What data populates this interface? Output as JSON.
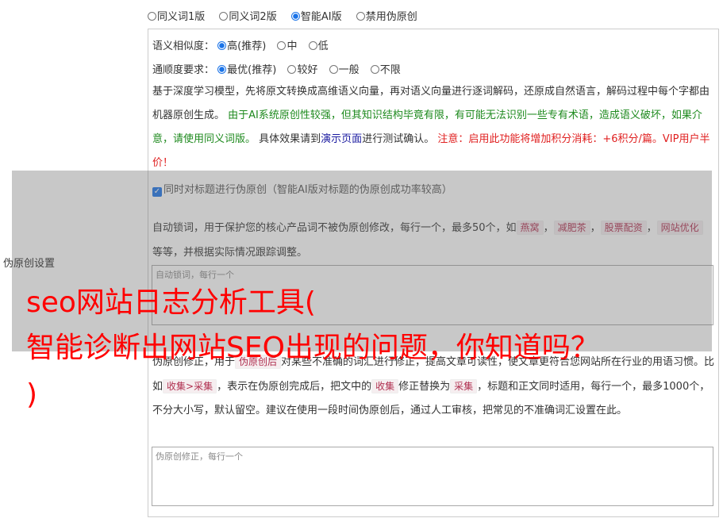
{
  "mode_options": [
    {
      "label": "同义词1版",
      "selected": false
    },
    {
      "label": "同义词2版",
      "selected": false
    },
    {
      "label": "智能AI版",
      "selected": true
    },
    {
      "label": "禁用伪原创",
      "selected": false
    }
  ],
  "similarity": {
    "label": "语义相似度：",
    "options": [
      {
        "label": "高(推荐)",
        "selected": true
      },
      {
        "label": "中",
        "selected": false
      },
      {
        "label": "低",
        "selected": false
      }
    ]
  },
  "fluency": {
    "label": "通顺度要求：",
    "options": [
      {
        "label": "最优(推荐)",
        "selected": true
      },
      {
        "label": "较好",
        "selected": false
      },
      {
        "label": "一般",
        "selected": false
      },
      {
        "label": "不限",
        "selected": false
      }
    ]
  },
  "description": {
    "part1": "基于深度学习模型，先将原文转换成高维语义向量，再对语义向量进行逐词解码，还原成自然语言，解码过程中每个字都由机器原创生成。",
    "part2_green": "由于AI系统原创性较强，但其知识结构毕竟有限，有可能无法识别一些专有术语，造成语义破坏，如果介意，请使用同义词版。",
    "part3": "具体效果请到",
    "link": "演示页面",
    "part4": "进行测试确认。",
    "part5_red": "注意：启用此功能将增加积分消耗：+6积分/篇。VIP用户半价！"
  },
  "title_checkbox": {
    "label": "同时对标题进行伪原创（智能AI版对标题的伪原创成功率较高）",
    "checked": true
  },
  "side_label": "伪原创设置",
  "lock_words": {
    "text_a": "自动锁词，用于保护您的核心产品词不被伪原创修改，每行一个，最多50个，如",
    "chips": [
      "燕窝",
      "减肥茶",
      "股票配资",
      "网站优化"
    ],
    "sep": "，",
    "text_b": "等等，并根据实际情况跟踪调整。",
    "placeholder": "自动锁词，每行一个"
  },
  "correction": {
    "text_a": "伪原创修正，用于",
    "chip1": "伪原创后",
    "text_b": "对某些不准确的词汇进行修正，提高文章可读性，使文章更符合您网站所在行业的用语习惯。比如",
    "chip2": "收集>采集",
    "text_c": "，表示在伪原创完成后，把文中的",
    "chip3": "收集",
    "text_d": "修正替换为",
    "chip4": "采集",
    "text_e": "，标题和正文同时适用，每行一个，最多1000个，不分大小写，默认留空。建议在使用一段时间伪原创后，通过人工审核，把常见的不准确词汇设置在此。",
    "placeholder": "伪原创修正，每行一个"
  },
  "overlay_title": {
    "line1": "seo网站日志分析工具(",
    "line2": "智能诊断出网站SEO出现的问题，你知道吗？",
    "line3": ")"
  },
  "colors": {
    "accent": "#1a73e8",
    "green": "#1e8a1e",
    "red": "#e02020",
    "overlay_text": "#ff0000"
  }
}
